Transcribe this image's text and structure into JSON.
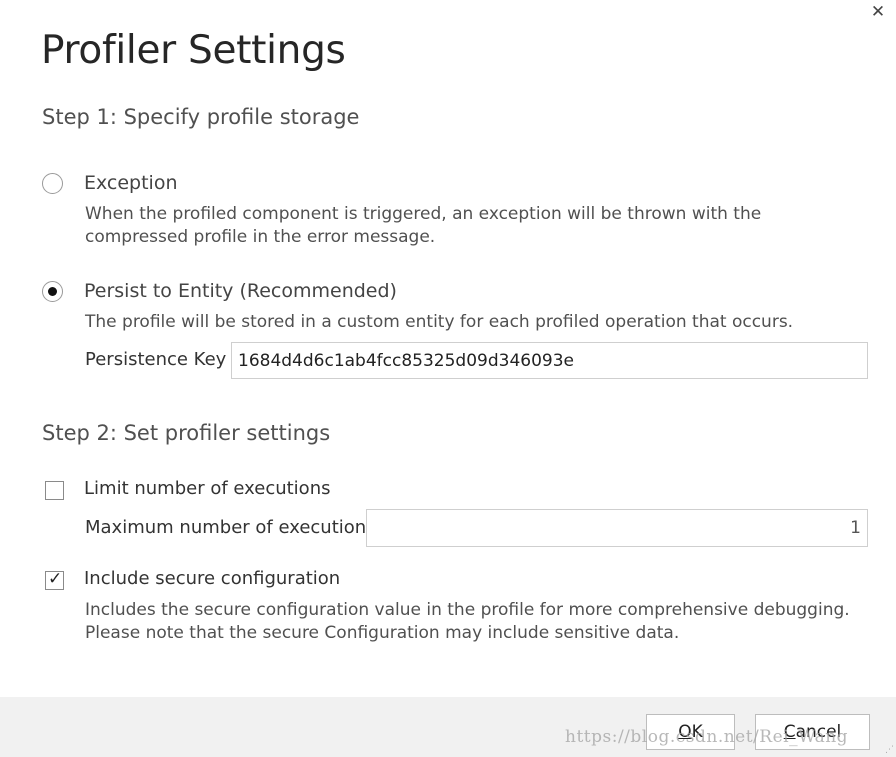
{
  "dialog": {
    "title": "Profiler Settings",
    "close_glyph": "✕"
  },
  "step1": {
    "heading": "Step 1: Specify profile storage",
    "exception": {
      "label": "Exception",
      "description_line1": "When the profiled component is triggered, an exception will be thrown with the",
      "description_line2": "compressed profile in the error message.",
      "selected": false
    },
    "persist": {
      "label": "Persist to Entity (Recommended)",
      "description": "The profile will be stored in a custom entity for each profiled operation that occurs.",
      "selected": true,
      "key_label": "Persistence Key",
      "key_value": "1684d4d6c1ab4fcc85325d09d346093e"
    }
  },
  "step2": {
    "heading": "Step 2: Set profiler settings",
    "limit": {
      "label": "Limit number of executions",
      "checked": false,
      "max_label": "Maximum number of executions",
      "max_value": "1"
    },
    "secure": {
      "label": "Include secure configuration",
      "checked": true,
      "tick_glyph": "✓",
      "description_line1": "Includes the secure configuration value in the profile for more comprehensive debugging.",
      "description_line2": "Please note that the secure Configuration may include sensitive data."
    }
  },
  "footer": {
    "ok_access_key": "O",
    "ok_rest": "K",
    "cancel_access_key": "C",
    "cancel_rest": "ancel"
  },
  "watermark": "https://blog.csdn.net/Rei_Wang"
}
